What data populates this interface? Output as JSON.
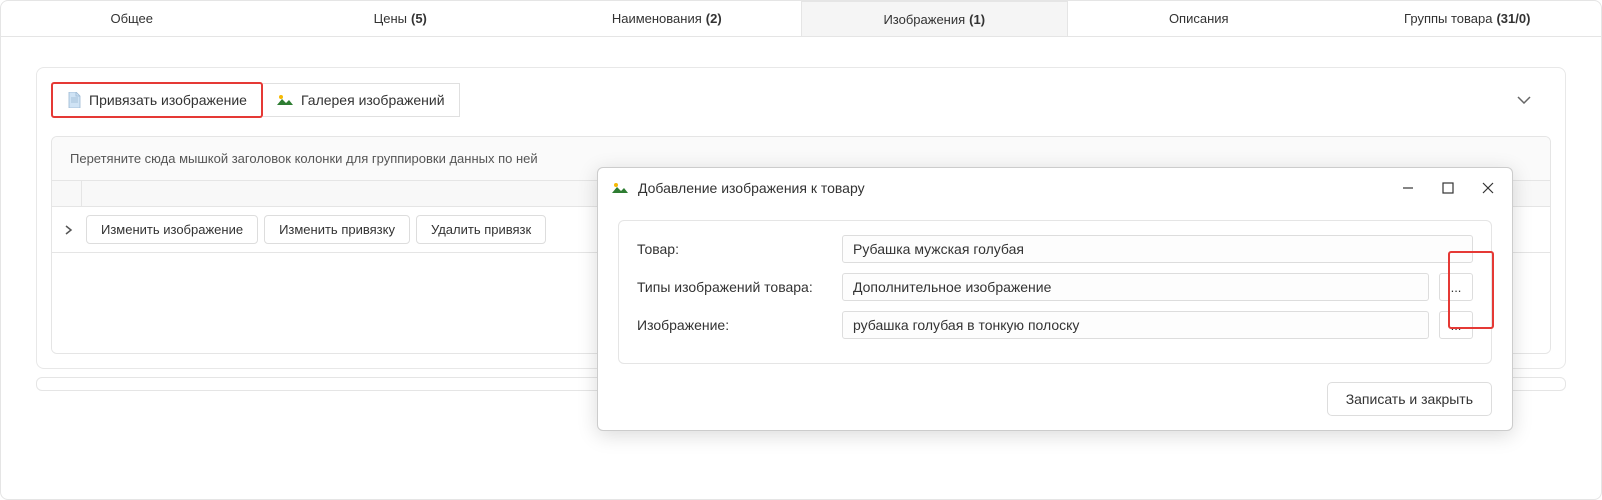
{
  "tabs": [
    {
      "label": "Общее",
      "count": ""
    },
    {
      "label": "Цены",
      "count": "(5)"
    },
    {
      "label": "Наименования",
      "count": "(2)"
    },
    {
      "label": "Изображения",
      "count": "(1)"
    },
    {
      "label": "Описания",
      "count": ""
    },
    {
      "label": "Группы товара",
      "count": "(31/0)"
    }
  ],
  "toolbar": {
    "bind_image": "Привязать изображение",
    "gallery": "Галерея изображений"
  },
  "grid": {
    "group_hint": "Перетяните сюда мышкой заголовок колонки для группировки данных по ней",
    "actions": {
      "edit_image": "Изменить изображение",
      "edit_binding": "Изменить привязку",
      "delete_binding": "Удалить привязк"
    }
  },
  "dialog": {
    "title": "Добавление изображения к товару",
    "product_label": "Товар:",
    "product_value": "Рубашка мужская голубая",
    "types_label": "Типы изображений товара:",
    "types_value": "Дополнительное изображение",
    "image_label": "Изображение:",
    "image_value": "рубашка голубая в тонкую полоску",
    "browse": "...",
    "save_close": "Записать и закрыть"
  }
}
